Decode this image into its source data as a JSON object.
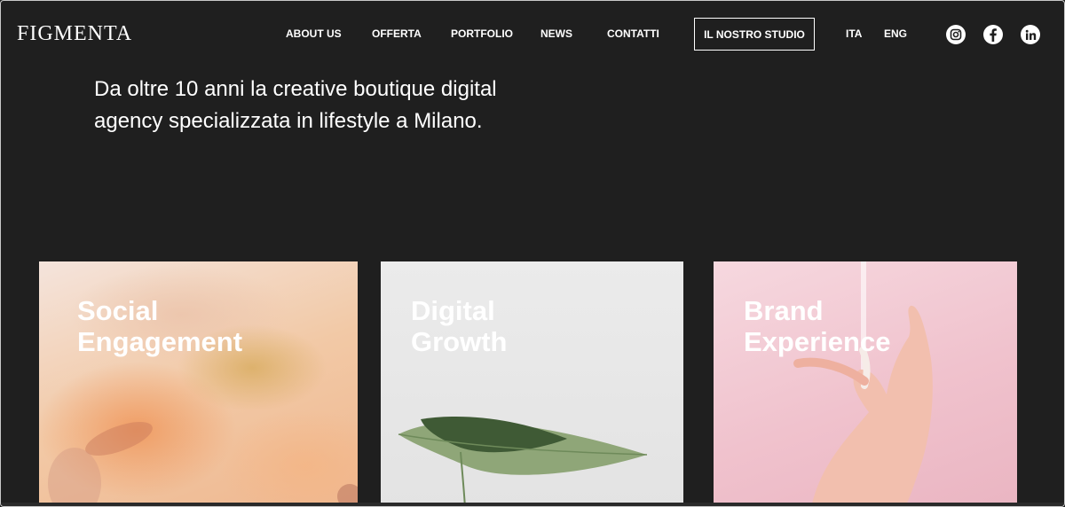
{
  "header": {
    "logo": "FIGMENTA",
    "nav": [
      "ABOUT US",
      "OFFERTA",
      "PORTFOLIO",
      "NEWS",
      "CONTATTI"
    ],
    "studio_button": "IL NOSTRO STUDIO",
    "languages": [
      "ITA",
      "ENG"
    ],
    "social_icons": [
      "instagram-icon",
      "facebook-icon",
      "linkedin-icon"
    ]
  },
  "hero": {
    "text": "Da oltre 10 anni la creative boutique digital agency specializzata in lifestyle a Milano."
  },
  "cards": [
    {
      "title_line1": "Social",
      "title_line2": "Engagement"
    },
    {
      "title_line1": "Digital",
      "title_line2": "Growth"
    },
    {
      "title_line1": "Brand",
      "title_line2": "Experience"
    }
  ],
  "colors": {
    "background": "#1f1f1f",
    "text": "#ffffff"
  }
}
